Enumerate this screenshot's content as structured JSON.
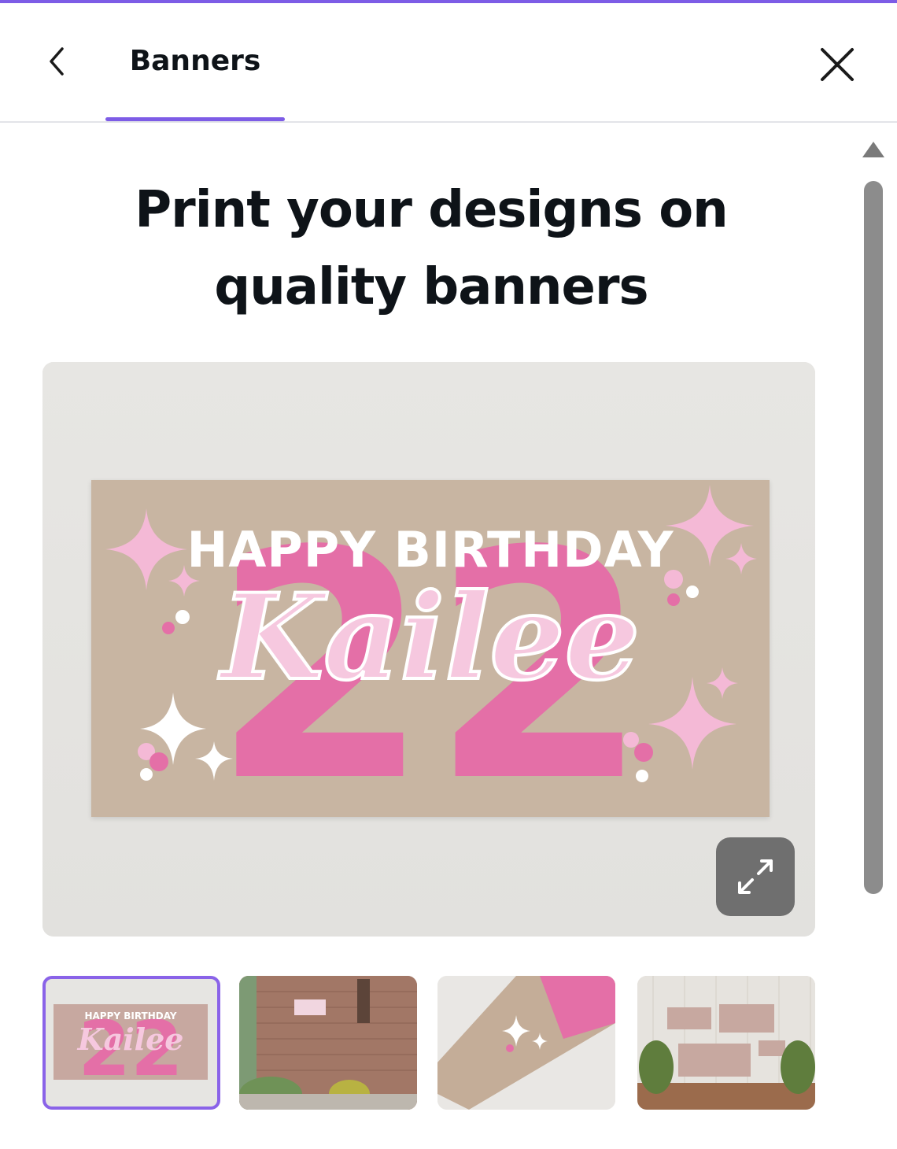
{
  "header": {
    "tab_label": "Banners"
  },
  "main": {
    "headline": "Print your designs on quality banners"
  },
  "preview": {
    "banner_headline": "HAPPY BIRTHDAY",
    "banner_name": "Kailee",
    "banner_number": "22"
  },
  "thumbnails": {
    "count": 4,
    "selected_index": 0,
    "mini_headline": "HAPPY BIRTHDAY",
    "mini_name": "Kailee"
  },
  "colors": {
    "accent": "#7d5ce6",
    "banner_bg": "#c8b5a2",
    "banner_number": "#e46fa7",
    "sparkle_pink": "#f4b9d6"
  },
  "icons": {
    "back": "chevron-left-icon",
    "close": "close-icon",
    "expand": "expand-icon",
    "scroll_up": "caret-up-icon"
  }
}
